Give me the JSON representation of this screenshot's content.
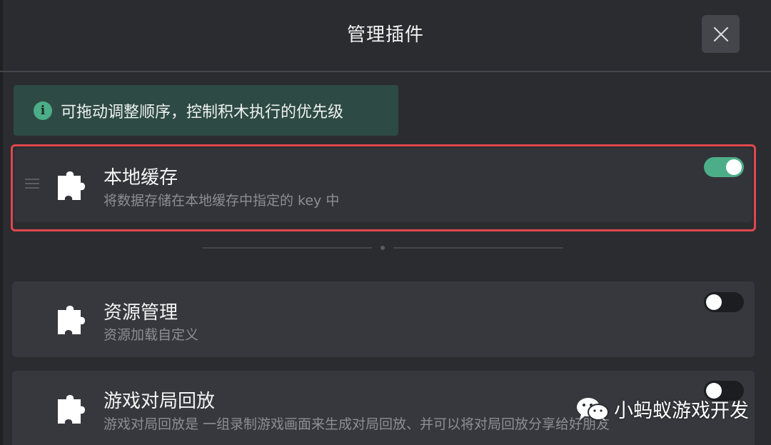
{
  "dialog": {
    "title": "管理插件",
    "close_icon": "close-icon"
  },
  "info_banner": {
    "icon": "info-icon",
    "icon_glyph": "i",
    "text": "可拖动调整顺序，控制积木执行的优先级"
  },
  "plugins": [
    {
      "name": "本地缓存",
      "description": "将数据存储在本地缓存中指定的 key 中",
      "enabled": true,
      "highlighted": true,
      "icon": "puzzle-icon"
    },
    {
      "name": "资源管理",
      "description": "资源加载自定义",
      "enabled": false,
      "icon": "puzzle-icon"
    },
    {
      "name": "游戏对局回放",
      "description": "游戏对局回放是 一组录制游戏画面来生成对局回放、并可以将对局回放分享给好朋友",
      "enabled": false,
      "icon": "puzzle-icon"
    }
  ],
  "watermark": {
    "icon": "wechat-icon",
    "text": "小蚂蚁游戏开发"
  },
  "colors": {
    "background": "#2b2c30",
    "card": "#37383d",
    "accent_green": "#4cae88",
    "banner_bg": "#2e4a44",
    "highlight_red": "#e0474c"
  }
}
